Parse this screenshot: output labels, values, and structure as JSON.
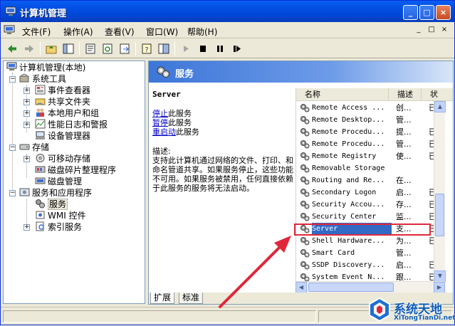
{
  "window": {
    "title": "计算机管理",
    "controls": [
      "_",
      "□",
      "×"
    ]
  },
  "menubar": {
    "items": [
      "文件(F)",
      "操作(A)",
      "查看(V)",
      "窗口(W)",
      "帮助(H)"
    ],
    "mdi_controls": [
      "_",
      "□",
      "×"
    ]
  },
  "toolbar": {
    "icons": [
      "back-arrow-icon",
      "forward-arrow-icon",
      "up-folder-icon",
      "show-hide-tree-icon",
      "properties-icon",
      "refresh-icon",
      "export-list-icon",
      "help-icon",
      "console-tree-icon",
      "play-icon",
      "stop-icon",
      "pause-icon",
      "restart-icon"
    ]
  },
  "tree": {
    "root": "计算机管理(本地)",
    "system_tools": "系统工具",
    "event_viewer": "事件查看器",
    "shared_folders": "共享文件夹",
    "local_users": "本地用户和组",
    "perf_logs": "性能日志和警报",
    "device_manager": "设备管理器",
    "storage": "存储",
    "removable_storage": "可移动存储",
    "defrag": "磁盘碎片整理程序",
    "disk_mgmt": "磁盘管理",
    "services_apps": "服务和应用程序",
    "services": "服务",
    "wmi": "WMI 控件",
    "indexing": "索引服务"
  },
  "panel": {
    "header_title": "服务",
    "service_name": "Server",
    "stop_link": "停止",
    "stop_suffix": "此服务",
    "pause_link": "暂停",
    "pause_suffix": "此服务",
    "restart_link": "重启动",
    "restart_suffix": "此服务",
    "desc_label": "描述:",
    "desc_text": "支持此计算机通过网络的文件、打印、和命名管道共享。如果服务停止，这些功能不可用。如果服务被禁用，任何直接依赖于此服务的服务将无法启动。"
  },
  "list": {
    "columns": [
      "名称",
      "描述",
      "状"
    ],
    "rows": [
      {
        "name": "Remote Access ...",
        "desc": "创...",
        "status": "已"
      },
      {
        "name": "Remote Desktop...",
        "desc": "管...",
        "status": ""
      },
      {
        "name": "Remote Procedu...",
        "desc": "提...",
        "status": "已"
      },
      {
        "name": "Remote Procedu...",
        "desc": "管...",
        "status": "已"
      },
      {
        "name": "Remote Registry",
        "desc": "使...",
        "status": "已"
      },
      {
        "name": "Removable Storage",
        "desc": "",
        "status": ""
      },
      {
        "name": "Routing and Re...",
        "desc": "在...",
        "status": ""
      },
      {
        "name": "Secondary Logon",
        "desc": "启...",
        "status": "已"
      },
      {
        "name": "Security Accou...",
        "desc": "存...",
        "status": "已"
      },
      {
        "name": "Security Center",
        "desc": "监...",
        "status": "已"
      },
      {
        "name": "Server",
        "desc": "支...",
        "status": "已"
      },
      {
        "name": "Shell Hardware...",
        "desc": "为...",
        "status": "已"
      },
      {
        "name": "Smart Card",
        "desc": "管...",
        "status": ""
      },
      {
        "name": "SSDP Discovery...",
        "desc": "启...",
        "status": "已"
      },
      {
        "name": "System Event N...",
        "desc": "跟...",
        "status": "已"
      }
    ],
    "selected_index": 10
  },
  "tabs": [
    "扩展",
    "标准"
  ],
  "watermark": {
    "text": "系统天地",
    "sub": "XiTongTianDi.net"
  }
}
